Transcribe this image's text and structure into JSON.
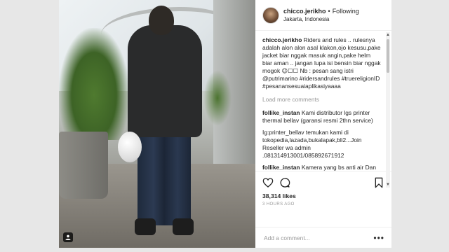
{
  "post": {
    "username": "chicco.jerikho",
    "separator": "•",
    "follow_label": "Following",
    "location": "Jakarta, Indonesia"
  },
  "comments": [
    {
      "user": "chicco.jerikho",
      "text": "Riders and rules .. rulesnya adalah alon alon asal klakon,ojo kesusu,pake jacket biar nggak masuk angin,pake helm biar aman .. jangan lupa isi bensin biar nggak mogok 😉☐☐ Nb : pesan sang istri @putrimarino #ridersandrules #truereligionID #pesanansesuaiaplikasiyaaaa"
    }
  ],
  "load_more_label": "Load more comments",
  "more_comments": [
    {
      "user": "follike_instan",
      "text": "Kami distributor lgs printer thermal bellav (garansi resmi 2thn service)"
    },
    {
      "user": "",
      "text": "Ig:printer_bellav temukan kami di tokopedia,lazada,bukalapak,bli2...Join Reseller wa admin .081314913001/085892671912"
    },
    {
      "user": "follike_instan",
      "text": "Kamera yang bs anti air Dan sudah teruji cocok buat anak muda Brand ThEYE (ti'ai) brand internasional"
    }
  ],
  "likes": "38,314 likes",
  "time_ago": "3 HOURS AGO",
  "add_comment_placeholder": "Add a comment...",
  "more_options": "•••",
  "icons": {
    "like": "heart-icon",
    "comment": "comment-icon",
    "save": "bookmark-icon",
    "tag": "user-tag-icon"
  },
  "colors": {
    "text": "#262626",
    "muted": "#999999",
    "border": "#efefef",
    "backdrop": "#e7e7e7"
  }
}
